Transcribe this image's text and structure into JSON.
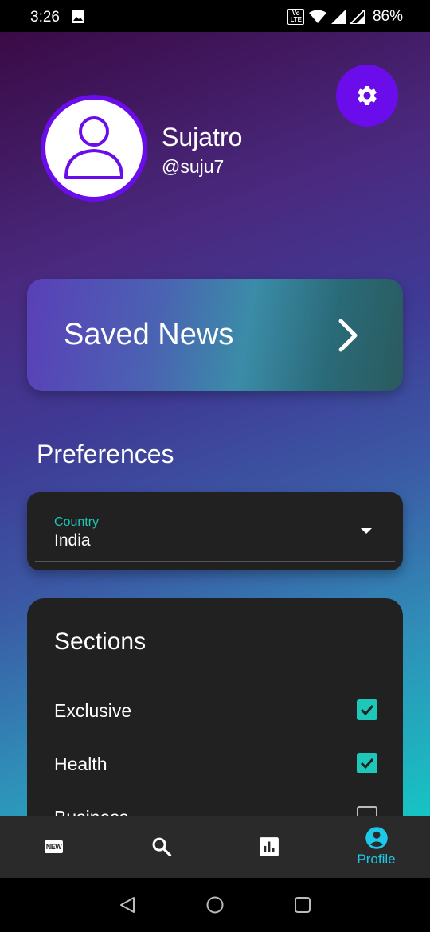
{
  "status_bar": {
    "time": "3:26",
    "lte_top": "Vo",
    "lte_bottom": "LTE",
    "battery": "86%"
  },
  "profile": {
    "name": "Sujatro",
    "handle": "@suju7"
  },
  "saved_news": {
    "label": "Saved News"
  },
  "preferences": {
    "title": "Preferences",
    "country": {
      "label": "Country",
      "value": "India"
    }
  },
  "sections": {
    "title": "Sections",
    "items": [
      {
        "label": "Exclusive",
        "checked": true
      },
      {
        "label": "Health",
        "checked": true
      },
      {
        "label": "Business",
        "checked": false
      }
    ]
  },
  "bottom_nav": {
    "items": [
      {
        "icon": "new-icon",
        "icon_text": "NEW"
      },
      {
        "icon": "search-icon"
      },
      {
        "icon": "chart-icon"
      },
      {
        "icon": "account-circle-icon",
        "label": "Profile",
        "active": true
      }
    ]
  },
  "colors": {
    "accent": "#6a0dea",
    "teal": "#1ec8b8",
    "card": "#212121",
    "active_nav": "#1ec8e8"
  }
}
